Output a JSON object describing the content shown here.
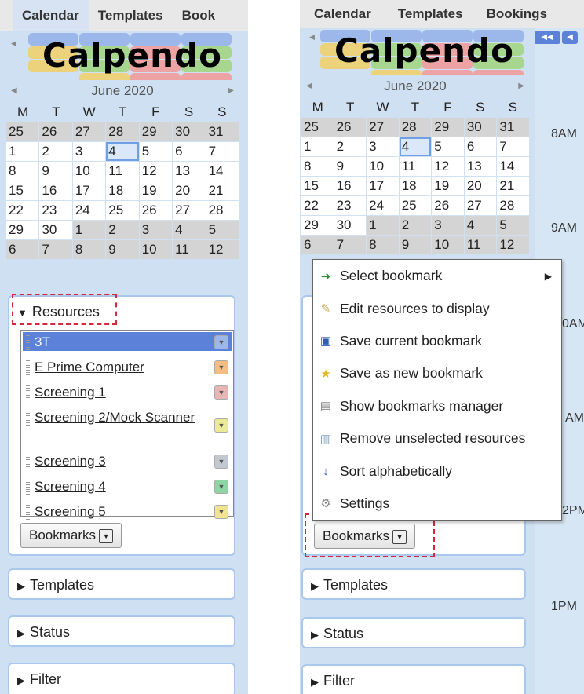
{
  "nav": {
    "tabs": [
      "Calendar",
      "Templates",
      "Bookings"
    ],
    "left_tab3_partial": "Book"
  },
  "logo": {
    "text": "Calpendo"
  },
  "calendar": {
    "month": "June 2020",
    "dow": [
      "M",
      "T",
      "W",
      "T",
      "F",
      "S",
      "S"
    ],
    "weeks": [
      [
        "25",
        "26",
        "27",
        "28",
        "29",
        "30",
        "31"
      ],
      [
        "1",
        "2",
        "3",
        "4",
        "5",
        "6",
        "7"
      ],
      [
        "8",
        "9",
        "10",
        "11",
        "12",
        "13",
        "14"
      ],
      [
        "15",
        "16",
        "17",
        "18",
        "19",
        "20",
        "21"
      ],
      [
        "22",
        "23",
        "24",
        "25",
        "26",
        "27",
        "28"
      ],
      [
        "29",
        "30",
        "1",
        "2",
        "3",
        "4",
        "5"
      ],
      [
        "6",
        "7",
        "8",
        "9",
        "10",
        "11",
        "12"
      ]
    ]
  },
  "resources": {
    "header": "Resources",
    "items": [
      {
        "label": "3T",
        "color": "#9cb8ea",
        "selected": true
      },
      {
        "label": "E Prime Computer",
        "color": "#f4bd84"
      },
      {
        "label": "Screening 1",
        "color": "#e8b5b5"
      },
      {
        "label": "Screening 2/Mock Scanner",
        "color": "#eceb95"
      },
      {
        "label": "Screening 3",
        "color": "#c3c7d0"
      },
      {
        "label": "Screening 4",
        "color": "#8fd4a4"
      },
      {
        "label": "Screening 5",
        "color": "#f0e490"
      }
    ],
    "bookmarks_label": "Bookmarks"
  },
  "sections": {
    "templates": "Templates",
    "status": "Status",
    "filter": "Filter"
  },
  "menu": {
    "items": [
      {
        "label": "Select bookmark",
        "icon": "arrow-icon"
      },
      {
        "label": "Edit resources to display",
        "icon": "pencil-icon"
      },
      {
        "label": "Save current bookmark",
        "icon": "floppy-icon"
      },
      {
        "label": "Save as new bookmark",
        "icon": "star-icon"
      },
      {
        "label": "Show bookmarks manager",
        "icon": "manager-icon"
      },
      {
        "label": "Remove unselected resources",
        "icon": "trash-icon"
      },
      {
        "label": "Sort alphabetically",
        "icon": "sort-az-icon"
      },
      {
        "label": "Settings",
        "icon": "gear-icon"
      }
    ]
  },
  "times": [
    "8AM",
    "9AM",
    "0AM",
    "AM",
    "2PM",
    "1PM"
  ],
  "colors": {
    "accent": "#5b82d8",
    "dash": "#d9263b",
    "panel": "#cfe0f2"
  }
}
